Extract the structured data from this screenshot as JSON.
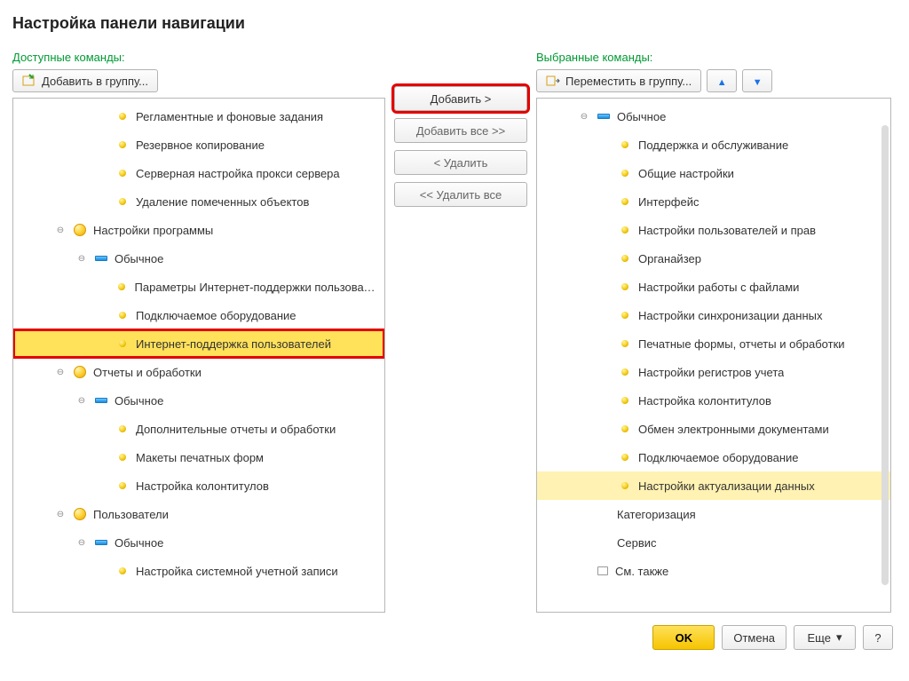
{
  "title": "Настройка панели навигации",
  "left": {
    "label": "Доступные команды:",
    "toolbar": {
      "add_to_group": "Добавить в группу..."
    },
    "items": [
      {
        "d": 4,
        "ic": "dot-y",
        "t": "Регламентные и фоновые задания"
      },
      {
        "d": 4,
        "ic": "dot-y",
        "t": "Резервное копирование"
      },
      {
        "d": 4,
        "ic": "dot-y",
        "t": "Серверная настройка прокси сервера"
      },
      {
        "d": 4,
        "ic": "dot-y",
        "t": "Удаление помеченных объектов"
      },
      {
        "d": 2,
        "ic": "ball",
        "t": "Настройки программы",
        "exp": "⊖"
      },
      {
        "d": 3,
        "ic": "bar",
        "t": "Обычное",
        "exp": "⊖"
      },
      {
        "d": 4,
        "ic": "dot-y",
        "t": "Параметры Интернет-поддержки пользователей"
      },
      {
        "d": 4,
        "ic": "dot-y",
        "t": "Подключаемое оборудование"
      },
      {
        "d": 4,
        "ic": "dot-y",
        "t": "Интернет-поддержка пользователей",
        "sel": "yellow",
        "hl": true
      },
      {
        "d": 2,
        "ic": "ball",
        "t": "Отчеты и обработки",
        "exp": "⊖"
      },
      {
        "d": 3,
        "ic": "bar",
        "t": "Обычное",
        "exp": "⊖"
      },
      {
        "d": 4,
        "ic": "dot-y",
        "t": "Дополнительные отчеты и обработки"
      },
      {
        "d": 4,
        "ic": "dot-y",
        "t": "Макеты печатных форм"
      },
      {
        "d": 4,
        "ic": "dot-y",
        "t": "Настройка колонтитулов"
      },
      {
        "d": 2,
        "ic": "ball",
        "t": "Пользователи",
        "exp": "⊖"
      },
      {
        "d": 3,
        "ic": "bar",
        "t": "Обычное",
        "exp": "⊖"
      },
      {
        "d": 4,
        "ic": "dot-y",
        "t": "Настройка системной учетной записи"
      }
    ]
  },
  "mid": {
    "add": "Добавить >",
    "add_all": "Добавить все >>",
    "remove": "< Удалить",
    "remove_all": "<< Удалить все"
  },
  "right": {
    "label": "Выбранные команды:",
    "toolbar": {
      "move_to_group": "Переместить в группу..."
    },
    "items": [
      {
        "d": 2,
        "ic": "bar",
        "t": "Обычное",
        "exp": "⊖"
      },
      {
        "d": 3,
        "ic": "dot-y",
        "t": "Поддержка и обслуживание"
      },
      {
        "d": 3,
        "ic": "dot-y",
        "t": "Общие настройки"
      },
      {
        "d": 3,
        "ic": "dot-y",
        "t": "Интерфейс"
      },
      {
        "d": 3,
        "ic": "dot-y",
        "t": "Настройки пользователей и прав"
      },
      {
        "d": 3,
        "ic": "dot-y",
        "t": "Органайзер"
      },
      {
        "d": 3,
        "ic": "dot-y",
        "t": "Настройки работы с файлами"
      },
      {
        "d": 3,
        "ic": "dot-y",
        "t": "Настройки синхронизации данных"
      },
      {
        "d": 3,
        "ic": "dot-y",
        "t": "Печатные формы, отчеты и обработки"
      },
      {
        "d": 3,
        "ic": "dot-y",
        "t": "Настройки регистров учета"
      },
      {
        "d": 3,
        "ic": "dot-y",
        "t": "Настройка колонтитулов"
      },
      {
        "d": 3,
        "ic": "dot-y",
        "t": "Обмен электронными документами"
      },
      {
        "d": 3,
        "ic": "dot-y",
        "t": "Подключаемое оборудование"
      },
      {
        "d": 3,
        "ic": "dot-y",
        "t": "Настройки актуализации данных",
        "sel": "soft"
      },
      {
        "d": 2,
        "ic": "none",
        "t": "Категоризация"
      },
      {
        "d": 2,
        "ic": "none",
        "t": "Сервис"
      },
      {
        "d": 2,
        "ic": "box",
        "t": "См. также"
      }
    ]
  },
  "footer": {
    "ok": "OK",
    "cancel": "Отмена",
    "more": "Еще",
    "help": "?"
  }
}
